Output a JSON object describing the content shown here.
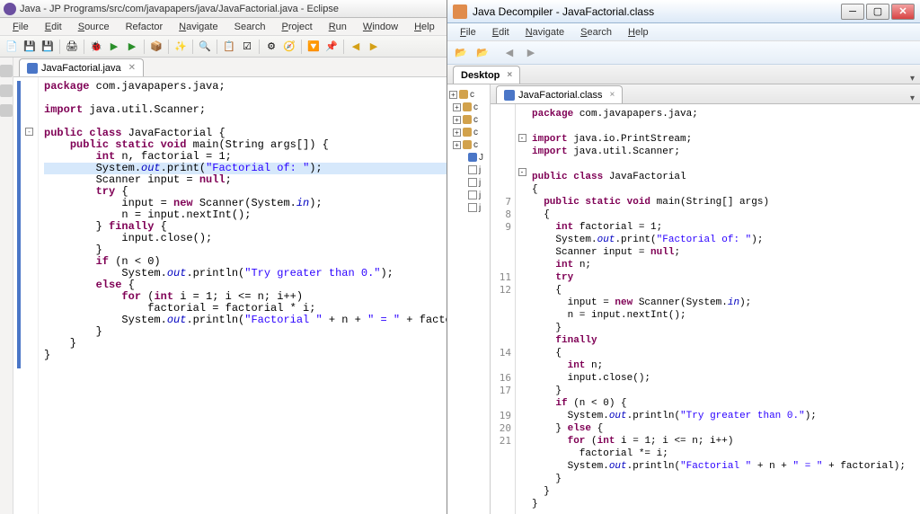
{
  "eclipse": {
    "title": "Java - JP Programs/src/com/javapapers/java/JavaFactorial.java - Eclipse",
    "menus": [
      "File",
      "Edit",
      "Source",
      "Refactor",
      "Navigate",
      "Search",
      "Project",
      "Run",
      "Window",
      "Help"
    ],
    "tab": {
      "label": "JavaFactorial.java",
      "close": "✕"
    },
    "code_html": "<span class='kw'>package</span> com.javapapers.java;\n\n<span class='kw'>import</span> java.util.Scanner;\n\n<span class='kw'>public class</span> JavaFactorial {\n    <span class='kw'>public static void</span> main(String args[]) {\n        <span class='kw'>int</span> n, factorial = 1;\n<span class='hl'>        System.<span class='sfield'>out</span>.print(<span class='str'>\"Factorial of: \"</span>);</span>\n        Scanner input = <span class='kw'>null</span>;\n        <span class='kw'>try</span> {\n            input = <span class='kw'>new</span> Scanner(System.<span class='sfield'>in</span>);\n            n = input.nextInt();\n        } <span class='kw'>finally</span> {\n            input.close();\n        }\n        <span class='kw'>if</span> (n &lt; 0)\n            System.<span class='sfield'>out</span>.println(<span class='str'>\"Try greater than 0.\"</span>);\n        <span class='kw'>else</span> {\n            <span class='kw'>for</span> (<span class='kw'>int</span> i = 1; i &lt;= n; i++)\n                factorial = factorial * i;\n            System.<span class='sfield'>out</span>.println(<span class='str'>\"Factorial \"</span> + n + <span class='str'>\" = \"</span> + factorial);\n        }\n    }\n}"
  },
  "jd": {
    "title": "Java Decompiler - JavaFactorial.class",
    "menus": [
      "File",
      "Edit",
      "Navigate",
      "Search",
      "Help"
    ],
    "desktop_tab": "Desktop",
    "file_tab": {
      "label": "JavaFactorial.class",
      "close": "×"
    },
    "tree_letters": [
      "c",
      "c",
      "c",
      "c",
      "c",
      "J",
      "j",
      "j",
      "j",
      "j"
    ],
    "line_numbers": "\n\n\n\n\n\n\n7\n8\n9\n\n\n\n11\n12\n\n\n\n\n14\n\n16\n17\n\n19\n20\n21\n\n\n\n",
    "code_html": "<span class='kw'>package</span> com.javapapers.java;\n\n<span class='kw'>import</span> java.io.PrintStream;\n<span class='kw'>import</span> java.util.Scanner;\n\n<span class='kw'>public class</span> JavaFactorial\n{\n  <span class='kw'>public static void</span> main(String[] args)\n  {\n    <span class='kw'>int</span> factorial = 1;\n    System.<span class='sfield'>out</span>.print(<span class='str'>\"Factorial of: \"</span>);\n    Scanner input = <span class='kw'>null</span>;\n    <span class='kw'>int</span> n;\n    <span class='kw'>try</span>\n    {\n      input = <span class='kw'>new</span> Scanner(System.<span class='sfield'>in</span>);\n      n = input.nextInt();\n    }\n    <span class='kw'>finally</span>\n    {\n      <span class='kw'>int</span> n;\n      input.close();\n    }\n    <span class='kw'>if</span> (n &lt; 0) {\n      System.<span class='sfield'>out</span>.println(<span class='str'>\"Try greater than 0.\"</span>);\n    } <span class='kw'>else</span> {\n      <span class='kw'>for</span> (<span class='kw'>int</span> i = 1; i &lt;= n; i++)\n        factorial *= i;\n      System.<span class='sfield'>out</span>.println(<span class='str'>\"Factorial \"</span> + n + <span class='str'>\" = \"</span> + factorial);\n    }\n  }\n}"
  }
}
